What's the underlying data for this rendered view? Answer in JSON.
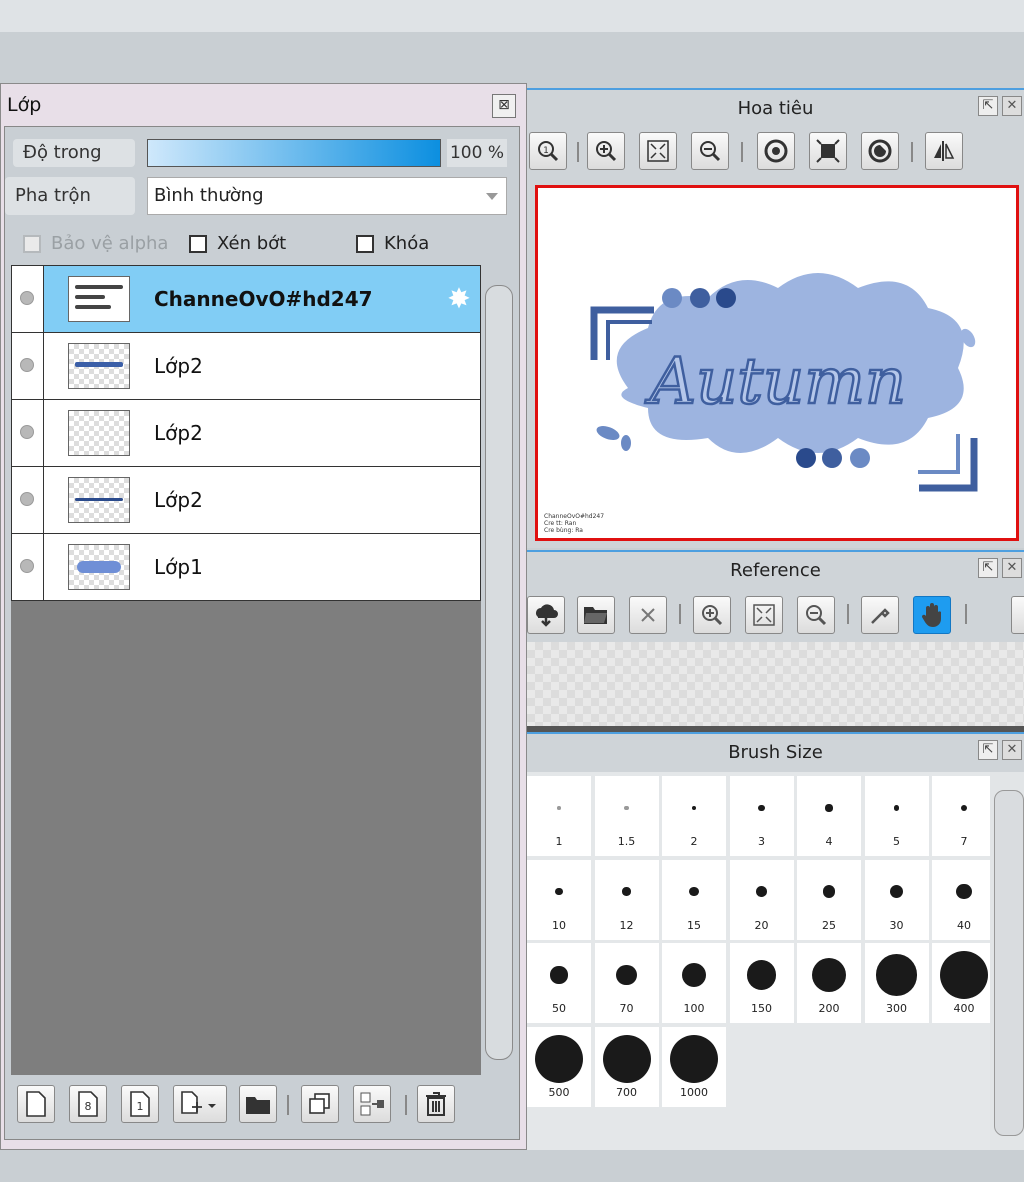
{
  "layer_panel": {
    "title": "Lớp",
    "close_glyph": "⊠",
    "opacity_label": "Độ trong",
    "opacity_value": "100 %",
    "opacity_fraction": 1.0,
    "blend_label": "Pha trộn",
    "blend_value": "Bình thường",
    "checkboxes": {
      "alpha": "Bảo vệ alpha",
      "clip": "Xén bớt",
      "lock": "Khóa"
    },
    "layers": [
      {
        "name": "ChanneOvO#hd247",
        "selected": true
      },
      {
        "name": "Lớp2",
        "selected": false
      },
      {
        "name": "Lớp2",
        "selected": false
      },
      {
        "name": "Lớp2",
        "selected": false
      },
      {
        "name": "Lớp1",
        "selected": false
      }
    ],
    "toolbar_icons": [
      "new-layer-icon",
      "new-8bit-layer-icon",
      "new-1bit-layer-icon",
      "new-layer-menu-icon",
      "new-folder-icon",
      "duplicate-layer-icon",
      "merge-down-icon",
      "delete-layer-icon"
    ]
  },
  "navigator": {
    "title": "Hoa tiêu",
    "canvas_text": "Autumn",
    "credit_lines": [
      "ChanneOvO#hd247",
      "Cre tt: Ran",
      "Cre bùng: Ra"
    ],
    "toolbar_icons": [
      "zoom-fit-icon",
      "zoom-in-icon",
      "fit-window-icon",
      "zoom-out-icon",
      "rotate-left-icon",
      "reset-view-icon",
      "rotate-right-icon",
      "flip-horizontal-icon"
    ]
  },
  "reference": {
    "title": "Reference",
    "toolbar_icons": [
      "load-cloud-icon",
      "open-folder-icon",
      "clear-icon",
      "zoom-in-icon",
      "fit-icon",
      "zoom-out-icon",
      "eyedropper-icon",
      "hand-icon"
    ]
  },
  "brush_size": {
    "title": "Brush Size",
    "sizes": [
      "1",
      "1.5",
      "2",
      "3",
      "4",
      "5",
      "7",
      "10",
      "12",
      "15",
      "20",
      "25",
      "30",
      "40",
      "50",
      "70",
      "100",
      "150",
      "200",
      "300",
      "400",
      "500",
      "700",
      "1000"
    ]
  },
  "colors": {
    "accent": "#4d9fe0",
    "selected_row": "#81cdf5",
    "hand_active": "#1e9cf0",
    "nav_border": "#e01010"
  }
}
